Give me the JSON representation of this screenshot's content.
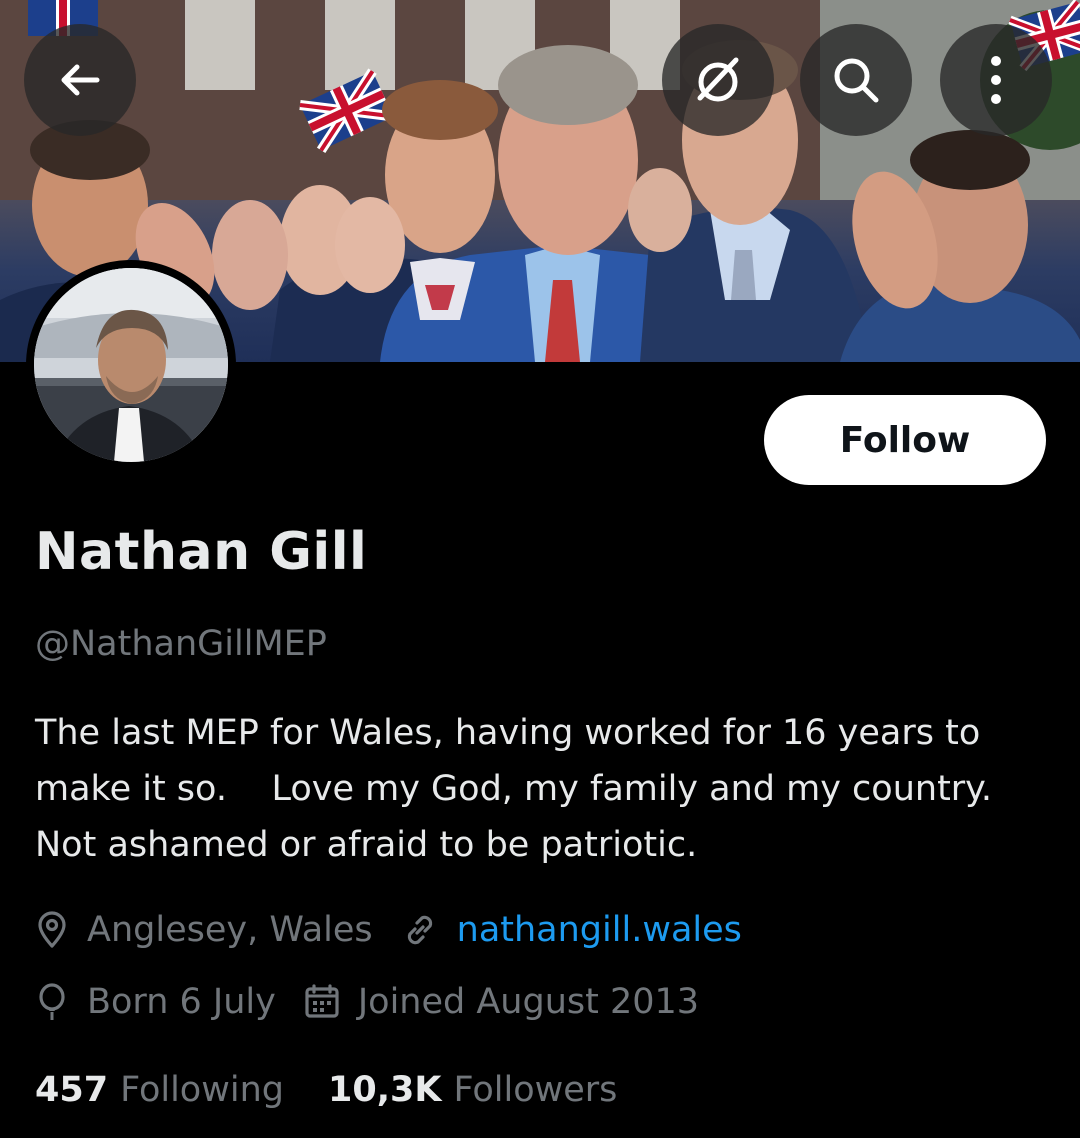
{
  "header": {
    "back_icon": "arrow-left-icon",
    "grok_icon": "grok-slash-circle-icon",
    "search_icon": "search-icon",
    "more_icon": "more-vertical-icon"
  },
  "profile": {
    "display_name": "Nathan Gill",
    "handle": "@NathanGillMEP",
    "bio": "The last MEP for Wales, having worked for 16 years to make it so.    Love my God, my family and my country.   Not ashamed or afraid to be patriotic.",
    "follow_label": "Follow"
  },
  "meta": {
    "location": "Anglesey, Wales",
    "website": "nathangill.wales",
    "birthday": "Born 6 July",
    "joined": "Joined August 2013"
  },
  "stats": {
    "following_count": "457",
    "following_label": "Following",
    "followers_count": "10,3K",
    "followers_label": "Followers"
  },
  "colors": {
    "background": "#000000",
    "text_primary": "#e7e9ea",
    "text_secondary": "#71767b",
    "link": "#1d9bf0",
    "follow_button_bg": "#ffffff"
  }
}
